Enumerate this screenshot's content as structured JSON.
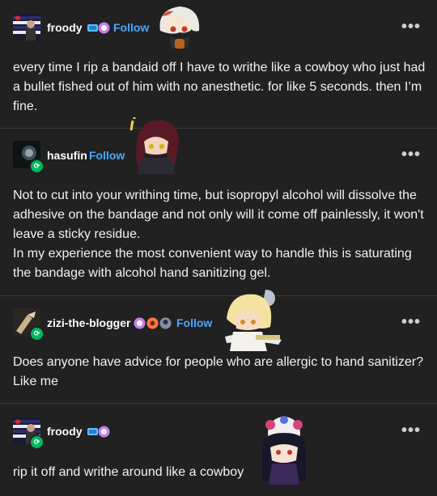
{
  "posts": [
    {
      "username": "froody",
      "follow_label": "Follow",
      "body": [
        "every time I rip a bandaid off I have to writhe like a cowboy who just had a bullet fished out of him with no anesthetic. for like 5 seconds. then I’m fine."
      ]
    },
    {
      "username": "hasufin",
      "follow_label": "Follow",
      "body": [
        "Not to cut into your writhing time, but isopropyl alcohol will dissolve the adhesive on the bandage and not only will it come off painlessly, it won't leave a sticky residue.",
        "In my experience the most convenient way to handle this is saturating the bandage with alcohol hand sanitizing gel."
      ]
    },
    {
      "username": "zizi-the-blogger",
      "follow_label": "Follow",
      "body": [
        "Does anyone have advice for people who are allergic to hand sanitizer? Like me"
      ]
    },
    {
      "username": "froody",
      "body": [
        "rip it off and writhe around like a cowboy"
      ]
    }
  ],
  "more_label": "•••",
  "colors": {
    "background": "#212121",
    "follow": "#4aa8ff",
    "reblog": "#00b85c"
  },
  "icons": [
    "reblog-icon",
    "more-options-icon",
    "blog-badge-icon",
    "sticker-image"
  ]
}
